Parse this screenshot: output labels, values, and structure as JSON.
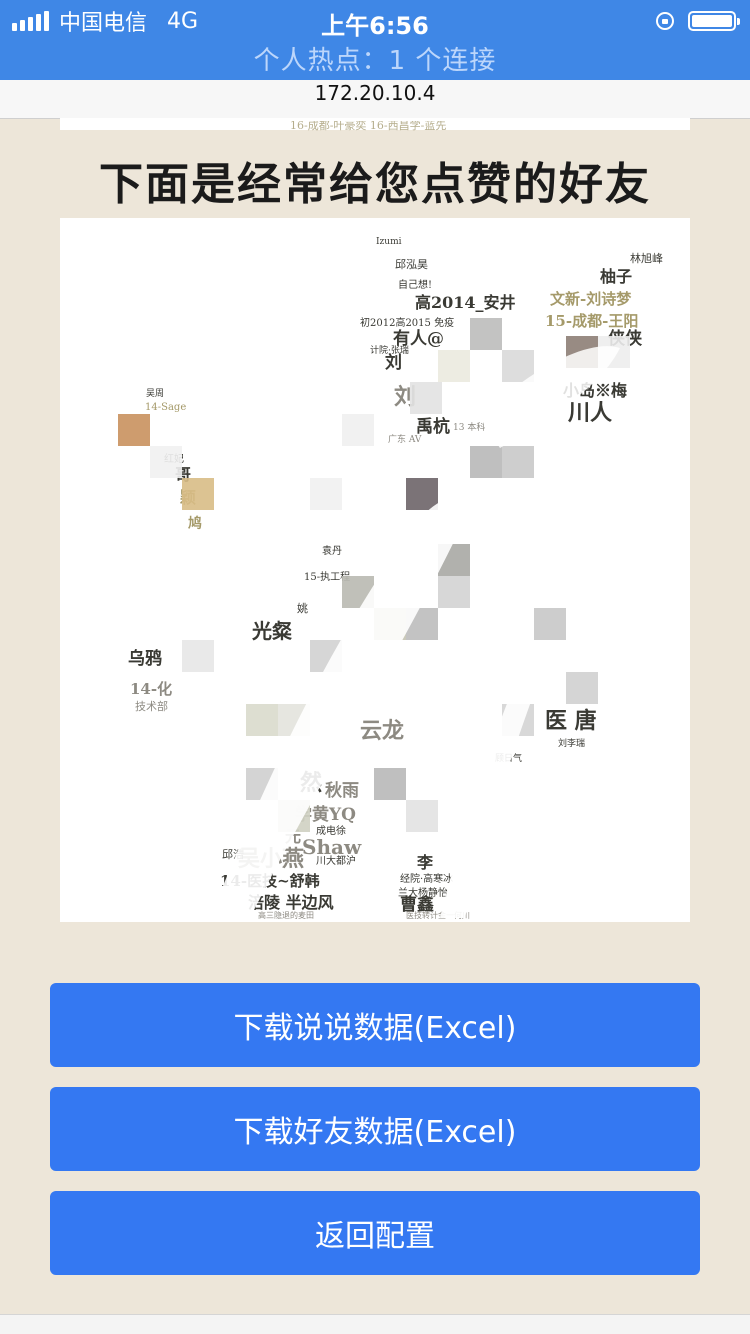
{
  "status_bar": {
    "carrier": "中国电信",
    "network": "4G",
    "time": "上午6:56",
    "hotspot": "个人热点：1 个连接",
    "icons": [
      "signal-icon",
      "rotation-lock-icon",
      "battery-icon"
    ]
  },
  "url_bar": {
    "address": "172.20.10.4"
  },
  "previous_image_caption": "16-成都-叶豪奕   16-西昌学-蓝先",
  "heading": "下面是经常给您点赞的好友",
  "word_cloud": {
    "words": [
      "Izumi",
      "邱泓昊",
      "自己想!",
      "林旭峰",
      "柚子",
      "高2014_安井",
      "文新-刘诗梦",
      "15-成都-王阳",
      "初2012高2015 免疫",
      "有人@",
      "侠侠",
      "计院·张瑞",
      "刘",
      "小岛※梅",
      "川人",
      "禹杭",
      "广东 AV",
      "13 本科",
      "吴周",
      "14-Sage",
      "红妃",
      "哥",
      "颖",
      "鸠",
      "光粲",
      "乌鸦",
      "14-化",
      "技术部",
      "袁丹",
      "15-执工程",
      "姚",
      "医 唐",
      "秋雨",
      "学黄YQ",
      "成电徐",
      "Shaw",
      "川大都沪",
      "李",
      "经院·高寒冰",
      "兰大杨静怡",
      "吴小燕",
      "14-医技~舒韩",
      "曹鑫",
      "涪陵 半边风",
      "高三隐退的麦田",
      "医技转计金一何川",
      "云龙",
      "然",
      "元",
      "邱浩",
      "刘李瑞",
      "顾日气",
      "刘"
    ]
  },
  "buttons": {
    "download_posts": "下载说说数据(Excel)",
    "download_friends": "下载好友数据(Excel)",
    "back_config": "返回配置"
  },
  "colors": {
    "status_bar": "#3f87e6",
    "button": "#3478f2",
    "page_background": "#ede6d9",
    "word_olive": "#a59a6a",
    "word_gray": "#8d8a82",
    "word_dark": "#3a3a34"
  }
}
